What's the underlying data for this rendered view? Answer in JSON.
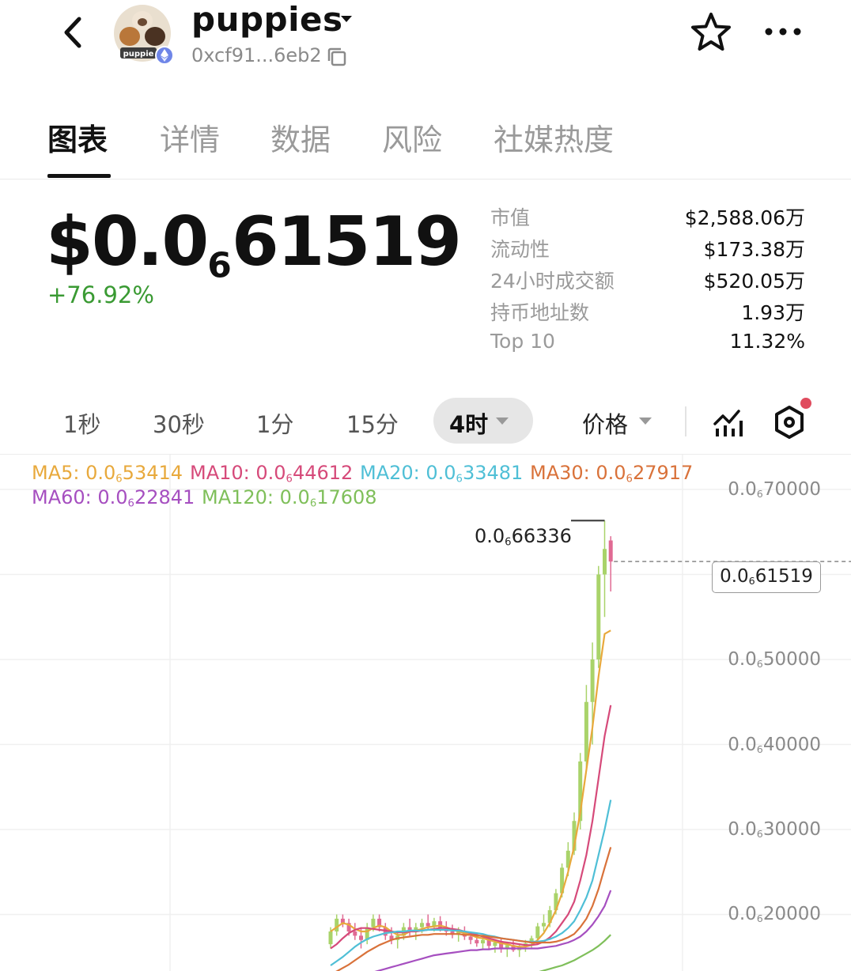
{
  "header": {
    "token_name": "puppies",
    "avatar_text": "puppie",
    "address": "0xcf91...6eb2"
  },
  "tabs": [
    {
      "label": "图表",
      "active": true
    },
    {
      "label": "详情",
      "active": false
    },
    {
      "label": "数据",
      "active": false
    },
    {
      "label": "风险",
      "active": false
    },
    {
      "label": "社媒热度",
      "active": false
    }
  ],
  "price": {
    "prefix": "$0.0",
    "zeros": "6",
    "digits": "61519",
    "change": "+76.92%",
    "change_color": "#3a9a33"
  },
  "stats": [
    {
      "label": "市值",
      "value": "$2,588.06万"
    },
    {
      "label": "流动性",
      "value": "$173.38万"
    },
    {
      "label": "24小时成交额",
      "value": "$520.05万"
    },
    {
      "label": "持币地址数",
      "value": "1.93万"
    },
    {
      "label": "Top 10",
      "value": "11.32%"
    }
  ],
  "timeframes": [
    {
      "label": "1秒",
      "active": false
    },
    {
      "label": "30秒",
      "active": false
    },
    {
      "label": "1分",
      "active": false
    },
    {
      "label": "15分",
      "active": false
    },
    {
      "label": "4时",
      "active": true
    }
  ],
  "price_type_label": "价格",
  "ma_indicators": [
    {
      "name": "MA5",
      "prefix": "MA5: 0.0",
      "zeros": "6",
      "digits": "53414",
      "color": "#e8a93c"
    },
    {
      "name": "MA10",
      "prefix": "MA10: 0.0",
      "zeros": "6",
      "digits": "44612",
      "color": "#d64a7a"
    },
    {
      "name": "MA20",
      "prefix": "MA20: 0.0",
      "zeros": "6",
      "digits": "33481",
      "color": "#4fbfd6"
    },
    {
      "name": "MA30",
      "prefix": "MA30: 0.0",
      "zeros": "6",
      "digits": "27917",
      "color": "#d9723a"
    },
    {
      "name": "MA60",
      "prefix": "MA60: 0.0",
      "zeros": "6",
      "digits": "22841",
      "color": "#a64fc0"
    },
    {
      "name": "MA120",
      "prefix": "MA120: 0.0",
      "zeros": "6",
      "digits": "17608",
      "color": "#7fbf5a"
    }
  ],
  "chart_data": {
    "type": "candlestick",
    "y_axis_ticks": [
      {
        "prefix": "0.0",
        "zeros": "6",
        "digits": "70000",
        "value": 7e-07
      },
      {
        "prefix": "0.0",
        "zeros": "6",
        "digits": "50000",
        "value": 5e-07
      },
      {
        "prefix": "0.0",
        "zeros": "6",
        "digits": "40000",
        "value": 4e-07
      },
      {
        "prefix": "0.0",
        "zeros": "6",
        "digits": "30000",
        "value": 3e-07
      },
      {
        "prefix": "0.0",
        "zeros": "6",
        "digits": "20000",
        "value": 2e-07
      }
    ],
    "high_label": {
      "prefix": "0.0",
      "zeros": "6",
      "digits": "66336",
      "value": 6.6336e-07
    },
    "current_label": {
      "prefix": "0.0",
      "zeros": "6",
      "digits": "61519",
      "value": 6.1519e-07
    },
    "unit": "1e-6",
    "ylim": [
      0.11,
      0.72
    ],
    "up_color": "#a9d36a",
    "down_color": "#e06a93",
    "candles": [
      [
        0.165,
        0.185,
        0.16,
        0.18
      ],
      [
        0.18,
        0.2,
        0.175,
        0.195
      ],
      [
        0.195,
        0.2,
        0.185,
        0.19
      ],
      [
        0.19,
        0.195,
        0.175,
        0.18
      ],
      [
        0.18,
        0.19,
        0.17,
        0.175
      ],
      [
        0.175,
        0.185,
        0.16,
        0.17
      ],
      [
        0.17,
        0.19,
        0.165,
        0.185
      ],
      [
        0.185,
        0.2,
        0.18,
        0.195
      ],
      [
        0.195,
        0.2,
        0.18,
        0.185
      ],
      [
        0.185,
        0.19,
        0.17,
        0.175
      ],
      [
        0.175,
        0.185,
        0.165,
        0.17
      ],
      [
        0.17,
        0.18,
        0.16,
        0.175
      ],
      [
        0.175,
        0.19,
        0.17,
        0.185
      ],
      [
        0.185,
        0.195,
        0.175,
        0.18
      ],
      [
        0.18,
        0.19,
        0.17,
        0.185
      ],
      [
        0.185,
        0.195,
        0.178,
        0.19
      ],
      [
        0.19,
        0.2,
        0.182,
        0.186
      ],
      [
        0.186,
        0.196,
        0.18,
        0.192
      ],
      [
        0.192,
        0.198,
        0.18,
        0.184
      ],
      [
        0.184,
        0.192,
        0.175,
        0.18
      ],
      [
        0.18,
        0.188,
        0.172,
        0.176
      ],
      [
        0.176,
        0.185,
        0.168,
        0.18
      ],
      [
        0.18,
        0.186,
        0.17,
        0.174
      ],
      [
        0.174,
        0.18,
        0.165,
        0.17
      ],
      [
        0.17,
        0.178,
        0.162,
        0.166
      ],
      [
        0.166,
        0.174,
        0.158,
        0.17
      ],
      [
        0.17,
        0.176,
        0.16,
        0.163
      ],
      [
        0.163,
        0.17,
        0.155,
        0.167
      ],
      [
        0.167,
        0.172,
        0.155,
        0.16
      ],
      [
        0.16,
        0.168,
        0.15,
        0.164
      ],
      [
        0.164,
        0.17,
        0.156,
        0.158
      ],
      [
        0.158,
        0.166,
        0.15,
        0.162
      ],
      [
        0.162,
        0.17,
        0.156,
        0.166
      ],
      [
        0.166,
        0.175,
        0.16,
        0.172
      ],
      [
        0.172,
        0.19,
        0.168,
        0.186
      ],
      [
        0.186,
        0.2,
        0.18,
        0.19
      ],
      [
        0.19,
        0.21,
        0.185,
        0.205
      ],
      [
        0.205,
        0.23,
        0.2,
        0.225
      ],
      [
        0.225,
        0.26,
        0.22,
        0.255
      ],
      [
        0.255,
        0.285,
        0.245,
        0.275
      ],
      [
        0.275,
        0.32,
        0.27,
        0.31
      ],
      [
        0.31,
        0.39,
        0.3,
        0.38
      ],
      [
        0.38,
        0.47,
        0.37,
        0.45
      ],
      [
        0.45,
        0.52,
        0.4,
        0.5
      ],
      [
        0.5,
        0.61,
        0.49,
        0.6
      ],
      [
        0.6,
        0.66336,
        0.55,
        0.63
      ],
      [
        0.64,
        0.645,
        0.58,
        0.61519
      ]
    ],
    "ma_series": [
      {
        "name": "MA5",
        "color": "#e8a93c",
        "values": [
          0.18,
          0.185,
          0.19,
          0.188,
          0.183,
          0.18,
          0.18,
          0.184,
          0.187,
          0.185,
          0.18,
          0.176,
          0.176,
          0.18,
          0.181,
          0.183,
          0.185,
          0.186,
          0.187,
          0.185,
          0.182,
          0.18,
          0.178,
          0.176,
          0.173,
          0.172,
          0.17,
          0.168,
          0.166,
          0.165,
          0.163,
          0.162,
          0.162,
          0.164,
          0.17,
          0.178,
          0.19,
          0.205,
          0.225,
          0.25,
          0.28,
          0.32,
          0.37,
          0.42,
          0.48,
          0.53,
          0.53414
        ]
      },
      {
        "name": "MA10",
        "color": "#d64a7a",
        "values": [
          0.16,
          0.165,
          0.172,
          0.178,
          0.182,
          0.184,
          0.184,
          0.183,
          0.182,
          0.181,
          0.18,
          0.179,
          0.179,
          0.18,
          0.18,
          0.181,
          0.182,
          0.183,
          0.184,
          0.184,
          0.183,
          0.182,
          0.18,
          0.178,
          0.176,
          0.174,
          0.172,
          0.17,
          0.168,
          0.167,
          0.166,
          0.165,
          0.164,
          0.164,
          0.165,
          0.168,
          0.173,
          0.18,
          0.19,
          0.2,
          0.215,
          0.24,
          0.27,
          0.31,
          0.36,
          0.41,
          0.44612
        ]
      },
      {
        "name": "MA20",
        "color": "#4fbfd6",
        "values": [
          0.14,
          0.145,
          0.15,
          0.156,
          0.162,
          0.167,
          0.171,
          0.174,
          0.176,
          0.178,
          0.179,
          0.18,
          0.18,
          0.181,
          0.181,
          0.181,
          0.182,
          0.182,
          0.182,
          0.182,
          0.181,
          0.181,
          0.18,
          0.179,
          0.178,
          0.177,
          0.175,
          0.174,
          0.172,
          0.171,
          0.17,
          0.169,
          0.168,
          0.168,
          0.168,
          0.169,
          0.171,
          0.174,
          0.178,
          0.184,
          0.192,
          0.205,
          0.22,
          0.24,
          0.27,
          0.3,
          0.33481
        ]
      },
      {
        "name": "MA30",
        "color": "#d9723a",
        "values": [
          0.13,
          0.133,
          0.137,
          0.141,
          0.146,
          0.151,
          0.156,
          0.16,
          0.164,
          0.167,
          0.17,
          0.172,
          0.173,
          0.174,
          0.175,
          0.176,
          0.176,
          0.177,
          0.177,
          0.177,
          0.177,
          0.177,
          0.176,
          0.176,
          0.175,
          0.175,
          0.174,
          0.173,
          0.172,
          0.171,
          0.17,
          0.169,
          0.168,
          0.167,
          0.167,
          0.167,
          0.167,
          0.168,
          0.17,
          0.173,
          0.177,
          0.185,
          0.195,
          0.21,
          0.23,
          0.255,
          0.27917
        ]
      },
      {
        "name": "MA60",
        "color": "#a64fc0",
        "values": [
          0.12,
          0.121,
          0.122,
          0.124,
          0.126,
          0.128,
          0.13,
          0.132,
          0.134,
          0.136,
          0.138,
          0.14,
          0.142,
          0.144,
          0.146,
          0.148,
          0.15,
          0.152,
          0.153,
          0.154,
          0.155,
          0.156,
          0.157,
          0.158,
          0.158,
          0.159,
          0.159,
          0.16,
          0.16,
          0.16,
          0.16,
          0.16,
          0.16,
          0.16,
          0.16,
          0.161,
          0.162,
          0.163,
          0.165,
          0.167,
          0.17,
          0.174,
          0.18,
          0.188,
          0.198,
          0.21,
          0.22841
        ]
      },
      {
        "name": "MA120",
        "color": "#7fbf5a",
        "values": [
          null,
          null,
          null,
          null,
          null,
          null,
          null,
          null,
          null,
          null,
          null,
          null,
          null,
          null,
          null,
          null,
          null,
          null,
          null,
          null,
          null,
          null,
          null,
          null,
          null,
          null,
          null,
          null,
          null,
          null,
          null,
          null,
          null,
          0.13,
          0.132,
          0.134,
          0.136,
          0.138,
          0.14,
          0.143,
          0.146,
          0.15,
          0.154,
          0.158,
          0.163,
          0.169,
          0.17608
        ]
      }
    ]
  }
}
